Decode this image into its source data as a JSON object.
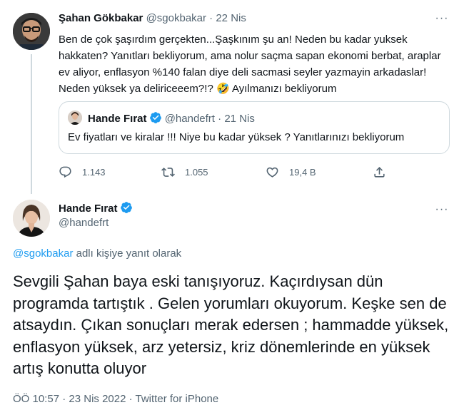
{
  "colors": {
    "text": "#0f1419",
    "secondary": "#536471",
    "accent": "#1d9bf0",
    "border": "#cfd9de"
  },
  "tweet1": {
    "author_name": "Şahan Gökbakar",
    "author_handle": "@sgokbakar",
    "separator": "·",
    "date": "22 Nis",
    "more_icon": "more-dots-icon",
    "text": "Ben de çok şaşırdım gerçekten...Şaşkınım şu an! Neden bu kadar yuksek hakkaten? Yanıtları bekliyorum, ama nolur saçma sapan ekonomi berbat, araplar ev aliyor, enflasyon %140 falan diye deli sacmasi seyler yazmayin arkadaslar! Neden yüksek ya deliriceeem?!?",
    "emoji": "🤣",
    "text_end": "Ayılmanızı bekliyorum",
    "quote": {
      "author_name": "Hande Fırat",
      "author_handle": "@handefrt",
      "separator": "·",
      "date": "21 Nis",
      "text": "Ev fiyatları ve kiralar !!! Niye bu kadar yüksek ? Yanıtlarınızı bekliyorum"
    },
    "actions": {
      "reply_count": "1.143",
      "retweet_count": "1.055",
      "like_count": "19,4 B",
      "reply_icon": "reply-icon",
      "retweet_icon": "retweet-icon",
      "like_icon": "heart-icon",
      "share_icon": "share-icon"
    }
  },
  "tweet2": {
    "author_name": "Hande Fırat",
    "author_handle": "@handefrt",
    "reply_mention": "@sgokbakar",
    "reply_suffix": " adlı kişiye yanıt olarak",
    "text": "Sevgili Şahan baya eski tanışıyoruz. Kaçırdıysan dün programda tartıştık . Gelen yorumları okuyorum. Keşke sen de atsaydın. Çıkan sonuçları merak edersen ; hammadde yüksek, enflasyon yüksek, arz yetersiz, kriz dönemlerinde en yüksek artış konutta oluyor",
    "time": "ÖÖ 10:57",
    "separator1": " · ",
    "date": "23 Nis 2022",
    "separator2": " · ",
    "source": "Twitter for iPhone"
  }
}
